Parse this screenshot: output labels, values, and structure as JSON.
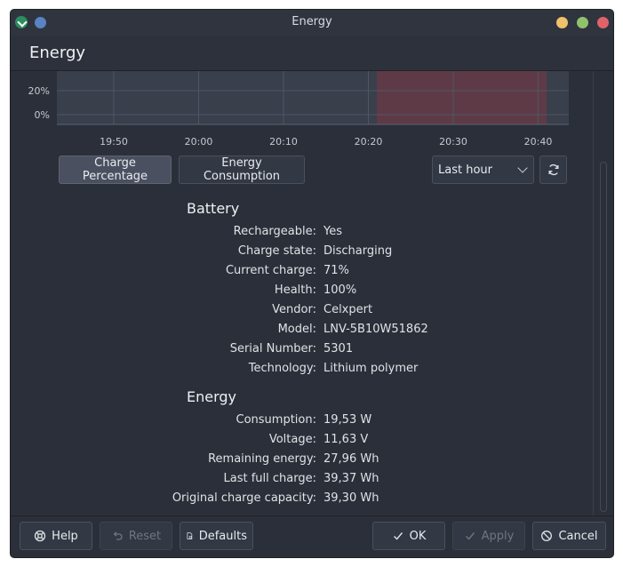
{
  "window": {
    "title": "Energy",
    "colors": {
      "close": "#e0636a",
      "maximize": "#8fc26a",
      "minimize": "#f1c16a",
      "pin": "#5a83c4",
      "app_icon": "#2c8d5e"
    }
  },
  "header": {
    "title": "Energy"
  },
  "chart_data": {
    "type": "area",
    "y_ticks": [
      "20%",
      "0%"
    ],
    "x_ticks": [
      "19:50",
      "20:00",
      "20:10",
      "20:20",
      "20:30",
      "20:40"
    ],
    "highlight_region": {
      "from": "20:21",
      "to": "20:41",
      "color": "#6b3a44"
    },
    "grid": true
  },
  "tabs": {
    "charge_percentage": "Charge Percentage",
    "energy_consumption": "Energy Consumption",
    "active": "charge_percentage"
  },
  "range_select": {
    "value": "Last hour"
  },
  "battery": {
    "title": "Battery",
    "rows": [
      {
        "label": "Rechargeable:",
        "value": "Yes"
      },
      {
        "label": "Charge state:",
        "value": "Discharging"
      },
      {
        "label": "Current charge:",
        "value": "71%"
      },
      {
        "label": "Health:",
        "value": "100%"
      },
      {
        "label": "Vendor:",
        "value": "Celxpert"
      },
      {
        "label": "Model:",
        "value": "LNV-5B10W51862"
      },
      {
        "label": "Serial Number:",
        "value": "5301"
      },
      {
        "label": "Technology:",
        "value": "Lithium polymer"
      }
    ]
  },
  "energy": {
    "title": "Energy",
    "rows": [
      {
        "label": "Consumption:",
        "value": "19,53 W"
      },
      {
        "label": "Voltage:",
        "value": "11,63 V"
      },
      {
        "label": "Remaining energy:",
        "value": "27,96 Wh"
      },
      {
        "label": "Last full charge:",
        "value": "39,37 Wh"
      },
      {
        "label": "Original charge capacity:",
        "value": "39,30 Wh"
      }
    ]
  },
  "footer": {
    "help": "Help",
    "reset": "Reset",
    "defaults": "Defaults",
    "ok": "OK",
    "apply": "Apply",
    "cancel": "Cancel"
  }
}
